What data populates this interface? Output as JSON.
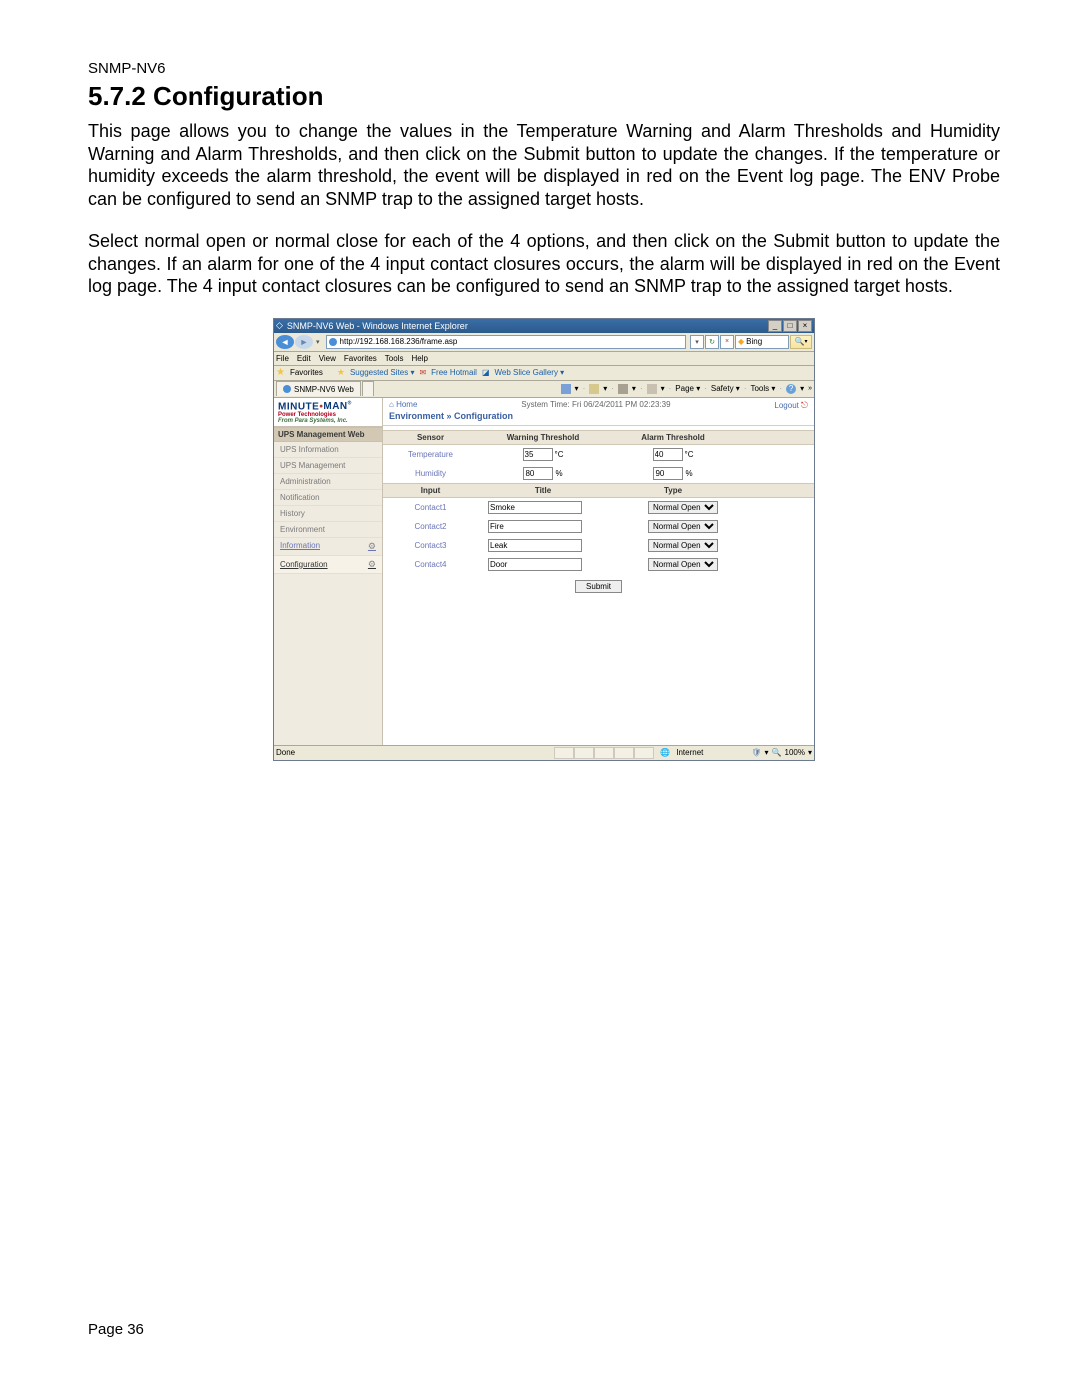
{
  "doc": {
    "header": "SNMP-NV6",
    "section_title": "5.7.2 Configuration",
    "para1": "This page allows you to change the values in the Temperature Warning and Alarm Thresholds and Humidity Warning and Alarm Thresholds, and then click on the Submit button to update the changes.  If the temperature or humidity exceeds the alarm threshold, the event will be displayed in red on the Event log page.  The ENV Probe can be configured to send an SNMP trap to the assigned target hosts.",
    "para2": "Select normal open or normal close for each of the 4 options, and then click on the Submit button to update the changes.  If an alarm for one of the 4 input contact closures occurs, the alarm will be displayed in red on the Event log page.  The 4 input contact closures can be configured to send an SNMP trap to the assigned target hosts.",
    "page_footer": "Page 36"
  },
  "ie": {
    "window_title": "SNMP-NV6 Web - Windows Internet Explorer",
    "url": "http://192.168.168.236/frame.asp",
    "search_provider": "Bing",
    "search_icon": "🔍",
    "menus": [
      "File",
      "Edit",
      "View",
      "Favorites",
      "Tools",
      "Help"
    ],
    "favorites_label": "Favorites",
    "fav_links": [
      "Suggested Sites ▾",
      "Free Hotmail",
      "Web Slice Gallery ▾"
    ],
    "tab_title": "SNMP-NV6 Web",
    "cmd_items": [
      "Page ▾",
      "Safety ▾",
      "Tools ▾"
    ],
    "status_done": "Done",
    "status_zone": "Internet",
    "status_protected": "",
    "status_zoom": "100%"
  },
  "app": {
    "logo_main": "MINUTEMAN",
    "logo_red": "Power Technologies",
    "logo_sub": "From Para Systems, Inc.",
    "side_header": "UPS Management Web",
    "side_items": [
      {
        "label": "UPS Information",
        "kind": "plain"
      },
      {
        "label": "UPS Management",
        "kind": "plain"
      },
      {
        "label": "Administration",
        "kind": "plain"
      },
      {
        "label": "Notification",
        "kind": "plain"
      },
      {
        "label": "History",
        "kind": "plain"
      },
      {
        "label": "Environment",
        "kind": "plain"
      },
      {
        "label": "Information",
        "kind": "link"
      },
      {
        "label": "Configuration",
        "kind": "sel"
      }
    ],
    "home_label": "Home",
    "breadcrumb": "Environment » Configuration",
    "system_time_label": "System Time:",
    "system_time_value": "Fri 06/24/2011 PM 02:23:39",
    "logout_label": "Logout",
    "sensor_header": {
      "c1": "Sensor",
      "c2": "Warning Threshold",
      "c3": "Alarm Threshold"
    },
    "sensors": [
      {
        "name": "Temperature",
        "warn": "35",
        "warn_unit": "°C",
        "alarm": "40",
        "alarm_unit": "°C"
      },
      {
        "name": "Humidity",
        "warn": "80",
        "warn_unit": "%",
        "alarm": "90",
        "alarm_unit": "%"
      }
    ],
    "input_header": {
      "c1": "Input",
      "c2": "Title",
      "c3": "Type"
    },
    "inputs": [
      {
        "name": "Contact1",
        "title": "Smoke",
        "type": "Normal Open"
      },
      {
        "name": "Contact2",
        "title": "Fire",
        "type": "Normal Open"
      },
      {
        "name": "Contact3",
        "title": "Leak",
        "type": "Normal Open"
      },
      {
        "name": "Contact4",
        "title": "Door",
        "type": "Normal Open"
      }
    ],
    "submit_label": "Submit"
  }
}
